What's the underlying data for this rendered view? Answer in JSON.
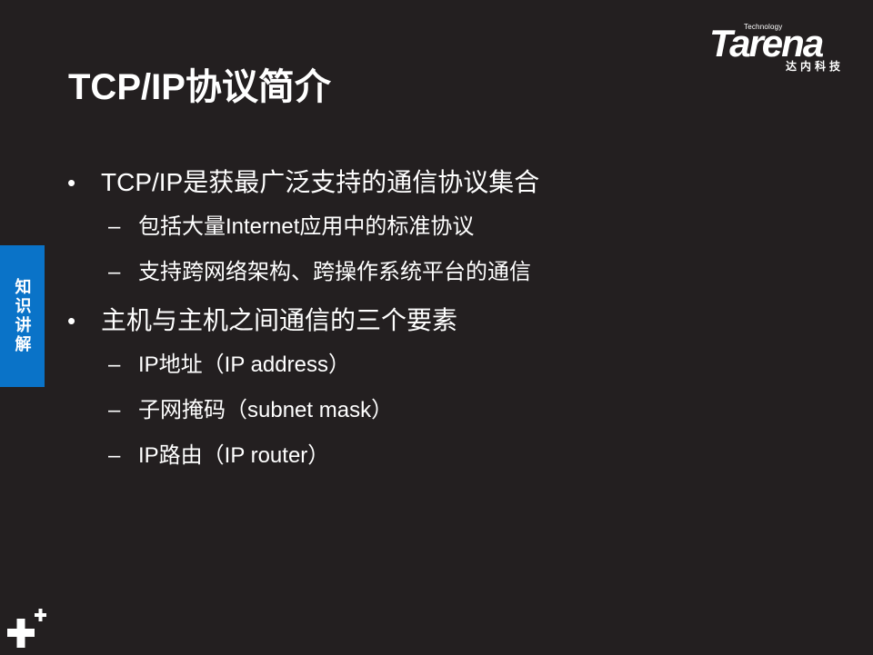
{
  "logo": {
    "technology": "Technology",
    "wordmark": "Tarena",
    "chinese": "达内科技"
  },
  "title": "TCP/IP协议简介",
  "side_tab": "知识讲解",
  "bullets": [
    {
      "level": 1,
      "marker": "•",
      "text": "TCP/IP是获最广泛支持的通信协议集合"
    },
    {
      "level": 2,
      "marker": "–",
      "text": "包括大量Internet应用中的标准协议"
    },
    {
      "level": 2,
      "marker": "–",
      "text": "支持跨网络架构、跨操作系统平台的通信"
    },
    {
      "level": 1,
      "marker": "•",
      "text": "主机与主机之间通信的三个要素"
    },
    {
      "level": 2,
      "marker": "–",
      "text": "IP地址（IP address）"
    },
    {
      "level": 2,
      "marker": "–",
      "text": "子网掩码（subnet mask）"
    },
    {
      "level": 2,
      "marker": "–",
      "text": "IP路由（IP router）"
    }
  ],
  "icons": {
    "corner": "plus-icon"
  },
  "colors": {
    "background": "#231f20",
    "side_tab": "#0a73c8",
    "text": "#ffffff"
  }
}
